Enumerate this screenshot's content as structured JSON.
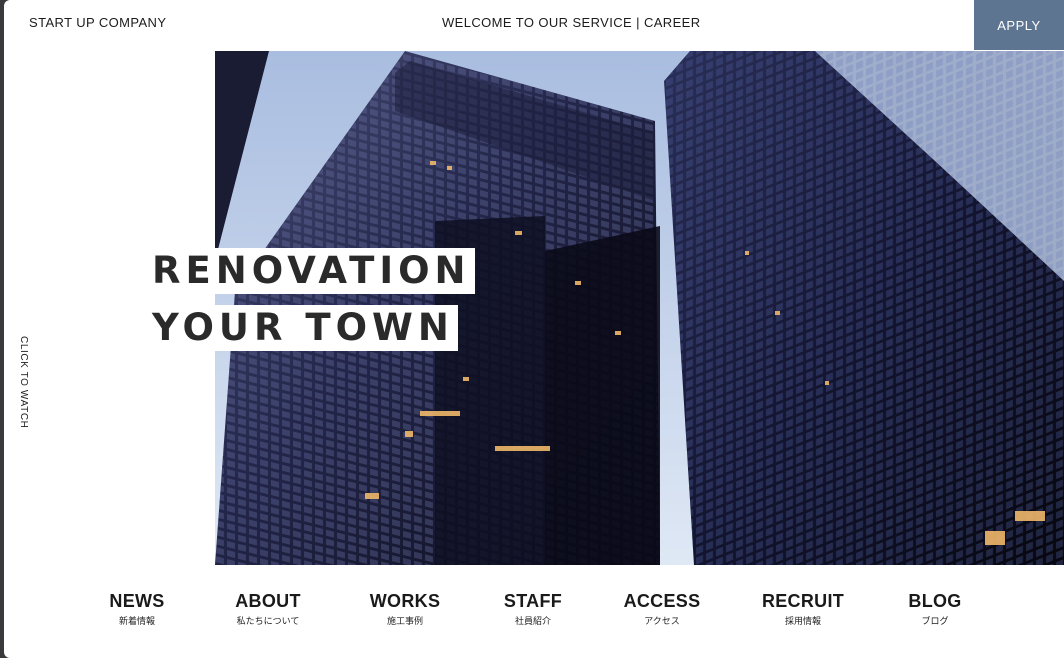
{
  "header": {
    "brand": "START UP COMPANY",
    "welcome_text": "WELCOME TO OUR SERVICE",
    "separator": "|",
    "career": "CAREER",
    "apply_label": "APPLY"
  },
  "hero": {
    "headline_line1": "RENOVATION",
    "headline_line2": "YOUR TOWN",
    "image_subject": "skyscrapers"
  },
  "side": {
    "watch_label": "CLICK TO WATCH"
  },
  "nav": {
    "items": [
      {
        "en": "NEWS",
        "jp": "新着情報"
      },
      {
        "en": "ABOUT",
        "jp": "私たちについて"
      },
      {
        "en": "WORKS",
        "jp": "施工事例"
      },
      {
        "en": "STAFF",
        "jp": "社員紹介"
      },
      {
        "en": "ACCESS",
        "jp": "アクセス"
      },
      {
        "en": "RECRUIT",
        "jp": "採用情報"
      },
      {
        "en": "BLOG",
        "jp": "ブログ"
      }
    ]
  },
  "colors": {
    "apply_bg": "#5d7591",
    "sky": "#b9c9e6",
    "building": "#14142a"
  }
}
